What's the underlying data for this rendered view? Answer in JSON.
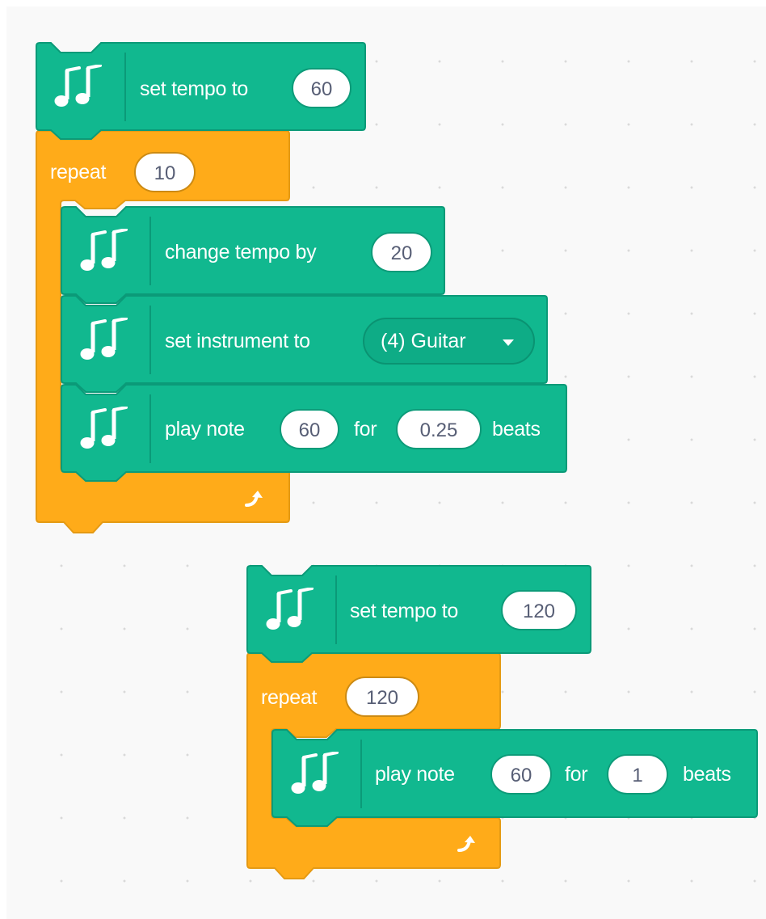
{
  "colors": {
    "music": "#11b88f",
    "music_border": "#0b9a78",
    "control": "#ffab19",
    "control_border": "#e59a14",
    "background": "#f9f9f9"
  },
  "icons": {
    "music": "music-notes-icon",
    "loop": "loop-arrow-icon",
    "dropdown": "caret-down-icon"
  },
  "script1": {
    "set_tempo": {
      "label": "set tempo to",
      "value": "60"
    },
    "repeat": {
      "label": "repeat",
      "value": "10"
    },
    "change_tempo": {
      "label": "change tempo by",
      "value": "20"
    },
    "set_instrument": {
      "label": "set instrument to",
      "value": "(4) Guitar"
    },
    "play_note": {
      "label": "play note",
      "note": "60",
      "for_label": "for",
      "beats": "0.25",
      "beats_label": "beats"
    }
  },
  "script2": {
    "set_tempo": {
      "label": "set tempo to",
      "value": "120"
    },
    "repeat": {
      "label": "repeat",
      "value": "120"
    },
    "play_note": {
      "label": "play note",
      "note": "60",
      "for_label": "for",
      "beats": "1",
      "beats_label": "beats"
    }
  }
}
